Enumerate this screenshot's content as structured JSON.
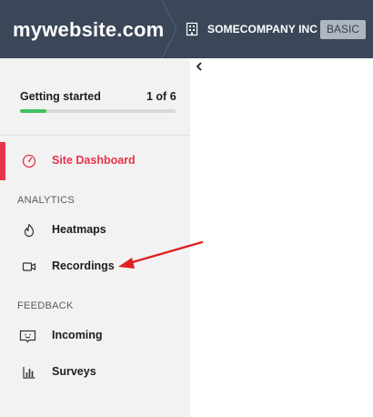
{
  "header": {
    "site_title": "mywebsite.com",
    "company_name": "SOMECOMPANY INC",
    "plan_badge": "BASIC"
  },
  "getting_started": {
    "label": "Getting started",
    "count": "1 of 6",
    "progress_fraction": 0.167
  },
  "nav": {
    "dashboard": {
      "label": "Site Dashboard",
      "icon": "speedometer-icon"
    },
    "analytics_heading": "ANALYTICS",
    "heatmaps": {
      "label": "Heatmaps",
      "icon": "flame-icon"
    },
    "recordings": {
      "label": "Recordings",
      "icon": "video-camera-icon"
    },
    "feedback_heading": "FEEDBACK",
    "incoming": {
      "label": "Incoming",
      "icon": "feedback-box-icon"
    },
    "surveys": {
      "label": "Surveys",
      "icon": "bar-chart-icon"
    }
  },
  "colors": {
    "header_bg": "#3b4658",
    "active_accent": "#e8334a",
    "progress_green": "#3ec25e",
    "annotation_red": "#e02020"
  }
}
